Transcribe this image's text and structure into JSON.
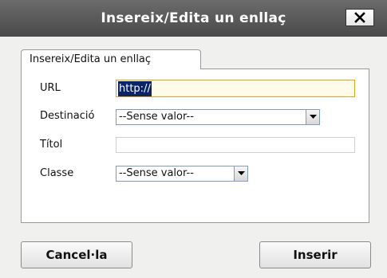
{
  "dialog": {
    "title": "Insereix/Edita un enllaç",
    "close_icon": "close-icon"
  },
  "tabs": [
    {
      "label": "Insereix/Edita un enllaç",
      "active": true
    }
  ],
  "form": {
    "url": {
      "label": "URL",
      "value": "http://"
    },
    "target": {
      "label": "Destinació",
      "selected": "--Sense valor--"
    },
    "title": {
      "label": "Títol",
      "value": ""
    },
    "class": {
      "label": "Classe",
      "selected": "--Sense valor--"
    }
  },
  "buttons": {
    "cancel_label": "Cancel·la",
    "insert_label": "Inserir"
  },
  "colors": {
    "titlebar": "#5a5a5a",
    "focus_border": "#e1a21c",
    "selection": "#0a246a"
  }
}
